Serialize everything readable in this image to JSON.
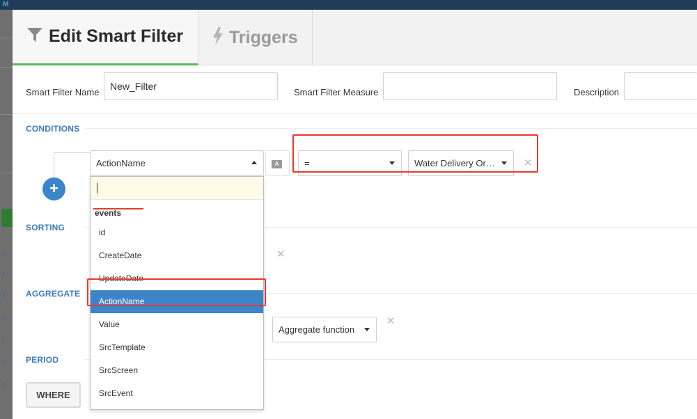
{
  "tabs": {
    "edit_label": "Edit Smart Filter",
    "triggers_label": "Triggers"
  },
  "fields": {
    "name_label": "Smart Filter Name",
    "name_value": "New_Filter",
    "measure_label": "Smart Filter Measure",
    "measure_value": "",
    "description_label": "Description",
    "description_value": ""
  },
  "sections": {
    "conditions": "CONDITIONS",
    "sorting": "SORTING",
    "aggregate": "AGGREGATE",
    "period": "PERIOD"
  },
  "condition": {
    "field_value": "ActionName",
    "type_badge": "A",
    "operator_value": "=",
    "value_value": "Water Delivery Or…",
    "add_icon": "+",
    "remove_icon": "✕"
  },
  "dropdown": {
    "search_value": "",
    "group_label": "events",
    "items": [
      "id",
      "CreateDate",
      "UpdateDate",
      "ActionName",
      "Value",
      "SrcTemplate",
      "SrcScreen",
      "SrcEvent"
    ],
    "selected": "ActionName"
  },
  "aggregate": {
    "function_placeholder": "Aggregate function"
  },
  "period": {
    "where_label": "WHERE"
  },
  "icons": {
    "edit_tab": "filter-icon",
    "triggers_tab": "lightning-icon"
  },
  "colors": {
    "accent_blue": "#3b86cb",
    "section_blue": "#3a7bbf",
    "active_tab_underline": "#5cb85c",
    "annotation_red": "#e83a2f",
    "selected_item": "#3e85c7"
  }
}
